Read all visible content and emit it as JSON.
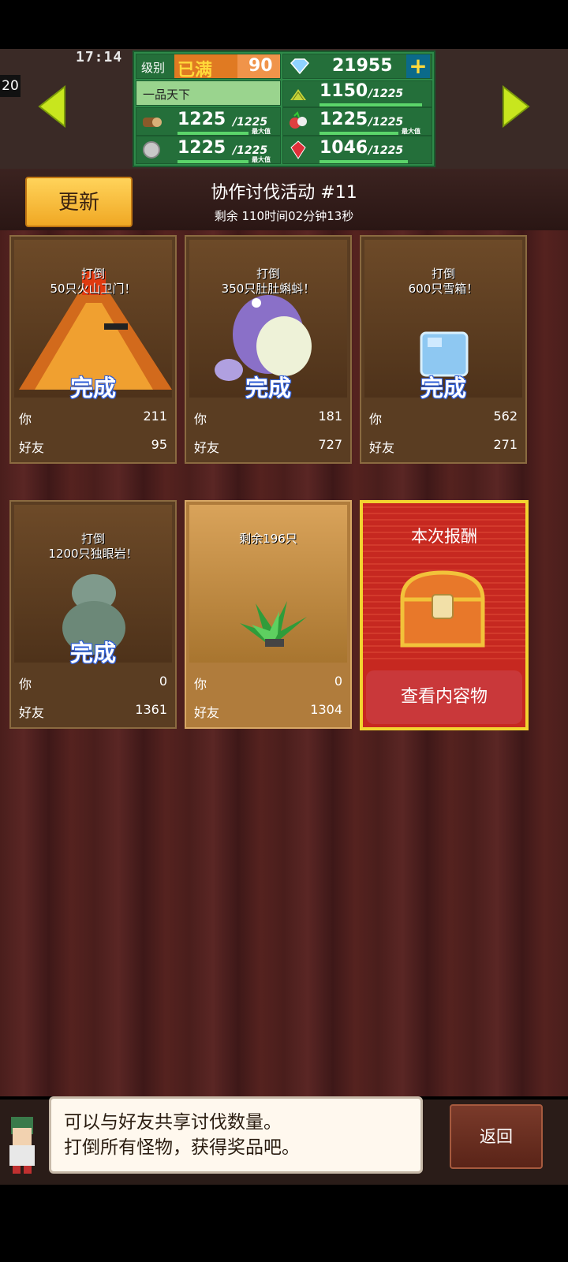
{
  "hud": {
    "clock": "17:14",
    "level_number": "20",
    "rank_label": "级别",
    "rank_status": "已满",
    "rank_value": "90",
    "title": "一品天下",
    "gems": "21955",
    "plus": "+",
    "resources": [
      {
        "name": "grain",
        "value": "1150",
        "max": "/1225",
        "fill": 0.94,
        "icon": "grain-icon",
        "max_tag": ""
      },
      {
        "name": "wood",
        "value": "1225",
        "max": "/1225",
        "fill": 1.0,
        "icon": "log-icon",
        "max_tag": "最大值"
      },
      {
        "name": "food",
        "value": "1225",
        "max": "/1225",
        "fill": 1.0,
        "icon": "vegetables-icon",
        "max_tag": "最大值"
      },
      {
        "name": "stone",
        "value": "1225",
        "max": "/1225",
        "fill": 1.0,
        "icon": "ore-icon",
        "max_tag": "最大值"
      },
      {
        "name": "ruby",
        "value": "1046",
        "max": "/1225",
        "fill": 0.85,
        "icon": "ruby-icon",
        "max_tag": ""
      }
    ]
  },
  "header": {
    "update_label": "更新",
    "title": "协作讨伐活动 #11",
    "remaining": "剩余 110时间02分钟13秒"
  },
  "cards": [
    {
      "target_line1": "打倒",
      "target_line2": "50只火山卫门！",
      "status": "完成",
      "you_label": "你",
      "you_value": "211",
      "friend_label": "好友",
      "friend_value": "95",
      "monster": "volcano-monster-icon"
    },
    {
      "target_line1": "打倒",
      "target_line2": "350只肚肚蝌蚪！",
      "status": "完成",
      "you_label": "你",
      "you_value": "181",
      "friend_label": "好友",
      "friend_value": "727",
      "monster": "tadpole-monster-icon"
    },
    {
      "target_line1": "打倒",
      "target_line2": "600只雪箱！",
      "status": "完成",
      "you_label": "你",
      "you_value": "562",
      "friend_label": "好友",
      "friend_value": "271",
      "monster": "ice-cube-monster-icon"
    },
    {
      "target_line1": "打倒",
      "target_line2": "1200只独眼岩！",
      "status": "完成",
      "you_label": "你",
      "you_value": "0",
      "friend_label": "好友",
      "friend_value": "1361",
      "monster": "rock-monster-icon"
    },
    {
      "target_line1": "剩余196只",
      "target_line2": "",
      "status": "",
      "you_label": "你",
      "you_value": "0",
      "friend_label": "好友",
      "friend_value": "1304",
      "monster": "plant-monster-icon"
    }
  ],
  "reward": {
    "title": "本次报酬",
    "view_label": "查看内容物"
  },
  "footer": {
    "message_line1": "可以与好友共享讨伐数量。",
    "message_line2": "打倒所有怪物，获得奖品吧。",
    "back_label": "返回"
  }
}
